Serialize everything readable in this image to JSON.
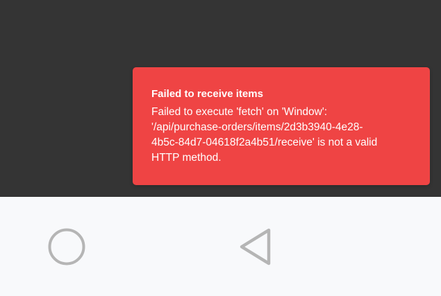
{
  "toast": {
    "title": "Failed to receive items",
    "message_lines": [
      "Failed to execute 'fetch' on 'Window':",
      "'/api/purchase-orders/items/2d3b3940-4e28-",
      "4b5c-84d7-04618f2a4b51/receive' is not a valid",
      "HTTP method."
    ],
    "color": "#ef4444",
    "text_color": "#ffffff"
  },
  "background": {
    "app_color": "#343434",
    "nav_color": "#f8f9fb"
  },
  "navigation": {
    "icon_color": "#b5b5b5",
    "buttons": [
      {
        "name": "home",
        "icon": "circle-icon"
      },
      {
        "name": "back",
        "icon": "triangle-back-icon"
      }
    ]
  }
}
